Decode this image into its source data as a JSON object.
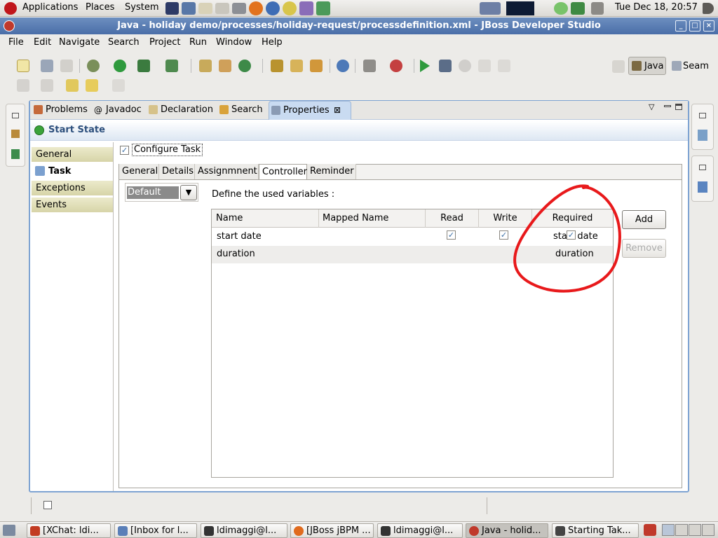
{
  "top_panel": {
    "menus": [
      "Applications",
      "Places",
      "System"
    ],
    "clock": "Tue Dec 18, 20:57"
  },
  "window": {
    "title": "Java - holiday demo/processes/holiday-request/processdefinition.xml - JBoss Developer Studio"
  },
  "menubar": {
    "items": [
      "File",
      "Edit",
      "Navigate",
      "Search",
      "Project",
      "Run",
      "Window",
      "Help"
    ]
  },
  "perspectives": {
    "java": "Java",
    "seam": "Seam"
  },
  "view_tabs": [
    "Problems",
    "Javadoc",
    "Declaration",
    "Search",
    "Properties"
  ],
  "header": {
    "title": "Start State"
  },
  "categories": [
    "General",
    "Task",
    "Exceptions",
    "Events"
  ],
  "configure_task": {
    "label": "Configure Task",
    "checked": true
  },
  "inner_tabs": [
    "General",
    "Details",
    "Assignmnent",
    "Controller",
    "Reminder"
  ],
  "controller": {
    "combo_value": "Default",
    "define_label": "Define the used variables :",
    "columns": [
      "Name",
      "Mapped Name",
      "Read",
      "Write",
      "Required"
    ],
    "rows": [
      {
        "name": "start date",
        "mapped": "",
        "read": true,
        "write": true,
        "required": true,
        "required_text": "start date"
      },
      {
        "name": "duration",
        "mapped": "",
        "read": false,
        "write": false,
        "required": false,
        "required_text": "duration"
      }
    ],
    "add_label": "Add",
    "remove_label": "Remove"
  },
  "taskbar": [
    {
      "label": "[XChat: ldi...",
      "icon": "xchat-icon",
      "color": "#c23b22"
    },
    {
      "label": "[Inbox for l...",
      "icon": "thunderbird-icon",
      "color": "#5a7fb8"
    },
    {
      "label": "ldimaggi@l...",
      "icon": "terminal-icon",
      "color": "#333333"
    },
    {
      "label": "[JBoss jBPM ...",
      "icon": "firefox-icon",
      "color": "#e06b1e"
    },
    {
      "label": "ldimaggi@l...",
      "icon": "terminal-icon",
      "color": "#333333"
    },
    {
      "label": "Java - holid...",
      "icon": "jbds-icon",
      "color": "#c0392b"
    },
    {
      "label": "Starting Tak...",
      "icon": "camera-icon",
      "color": "#444444"
    }
  ],
  "colors": {
    "accent": "#4a6ea8",
    "annotation": "#e8191b"
  }
}
